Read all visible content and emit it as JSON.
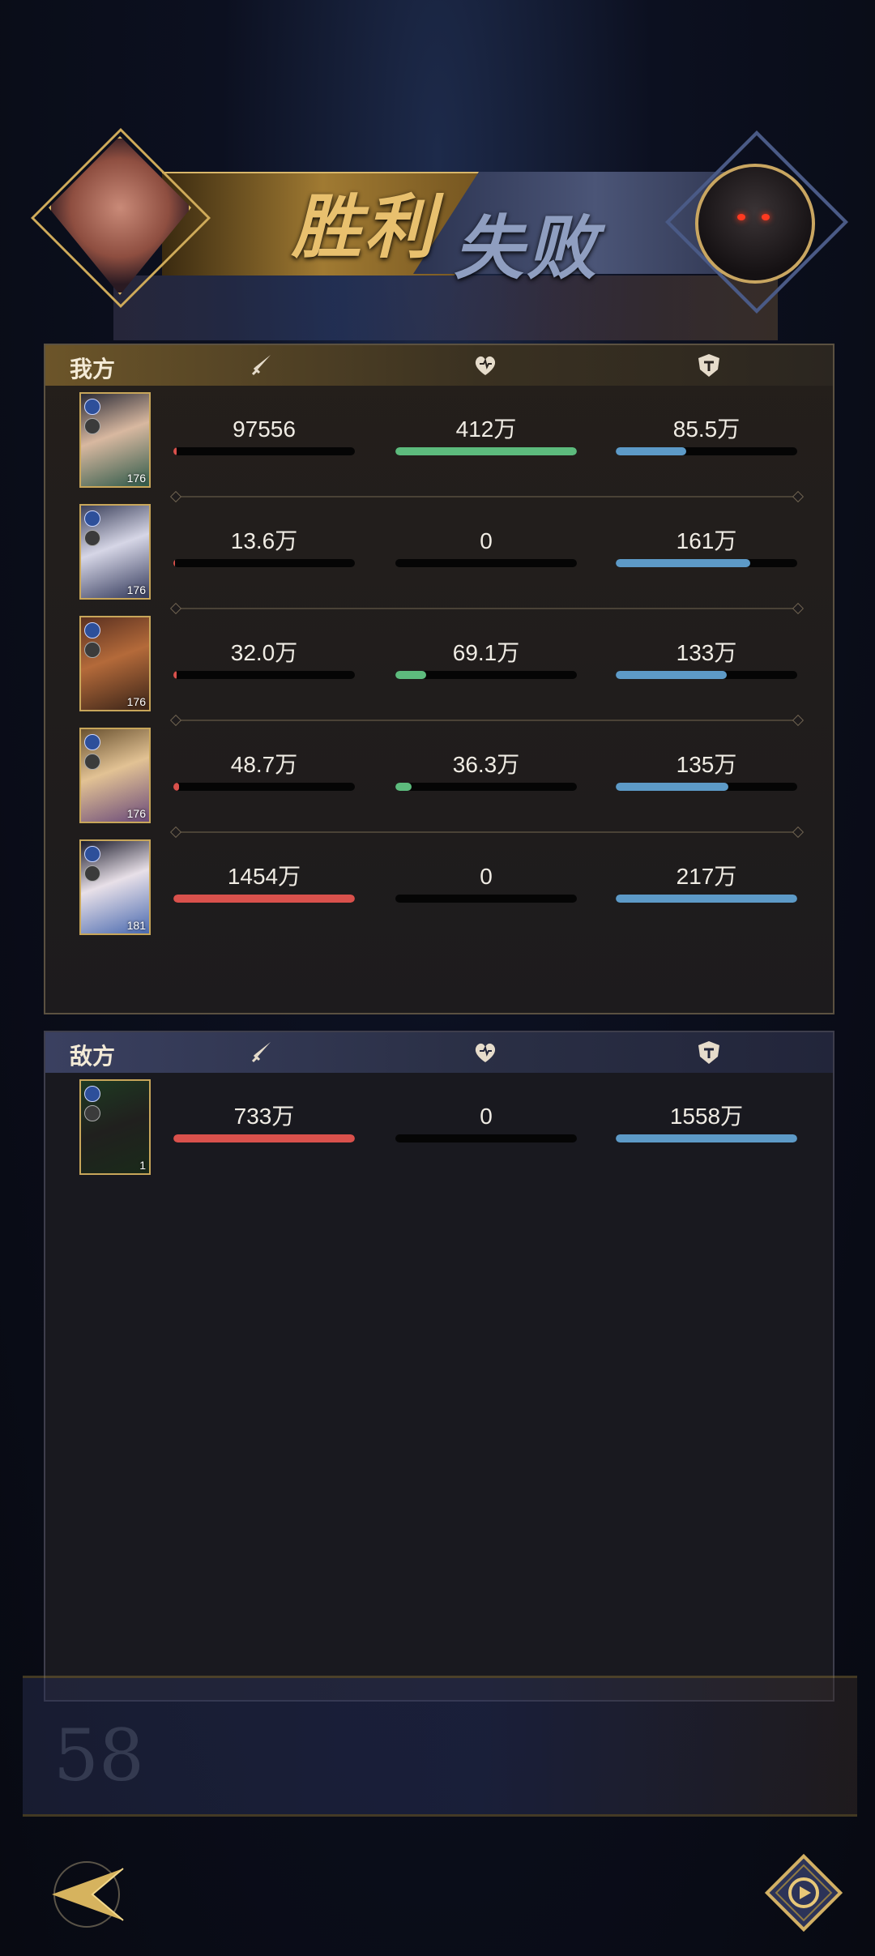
{
  "banner": {
    "victory_text": "胜利",
    "defeat_text": "失败"
  },
  "ally_panel": {
    "title": "我方",
    "header_icons": [
      "sword-icon",
      "heart-icon",
      "shield-icon"
    ],
    "rows": [
      {
        "level": "176",
        "attack": "97556",
        "heal": "412万",
        "defense": "85.5万",
        "attack_pct": 0.02,
        "heal_pct": 1.0,
        "defense_pct": 0.39
      },
      {
        "level": "176",
        "attack": "13.6万",
        "heal": "0",
        "defense": "161万",
        "attack_pct": 0.01,
        "heal_pct": 0.0,
        "defense_pct": 0.74
      },
      {
        "level": "176",
        "attack": "32.0万",
        "heal": "69.1万",
        "defense": "133万",
        "attack_pct": 0.02,
        "heal_pct": 0.17,
        "defense_pct": 0.61
      },
      {
        "level": "176",
        "attack": "48.7万",
        "heal": "36.3万",
        "defense": "135万",
        "attack_pct": 0.03,
        "heal_pct": 0.09,
        "defense_pct": 0.62
      },
      {
        "level": "181",
        "attack": "1454万",
        "heal": "0",
        "defense": "217万",
        "attack_pct": 1.0,
        "heal_pct": 0.0,
        "defense_pct": 1.0
      }
    ]
  },
  "enemy_panel": {
    "title": "敌方",
    "header_icons": [
      "sword-icon",
      "heart-icon",
      "shield-icon"
    ],
    "rows": [
      {
        "level": "1",
        "attack": "733万",
        "heal": "0",
        "defense": "1558万",
        "attack_pct": 1.0,
        "heal_pct": 0.0,
        "defense_pct": 1.0
      }
    ]
  },
  "background": {
    "level_number": "58"
  },
  "controls": {
    "back_icon": "back-arrow-icon",
    "replay_icon": "replay-icon"
  },
  "colors": {
    "attack_bar": "#d9514c",
    "heal_bar": "#5dbb7d",
    "defense_bar": "#5d9ac7",
    "gold_accent": "#c8a65a"
  }
}
